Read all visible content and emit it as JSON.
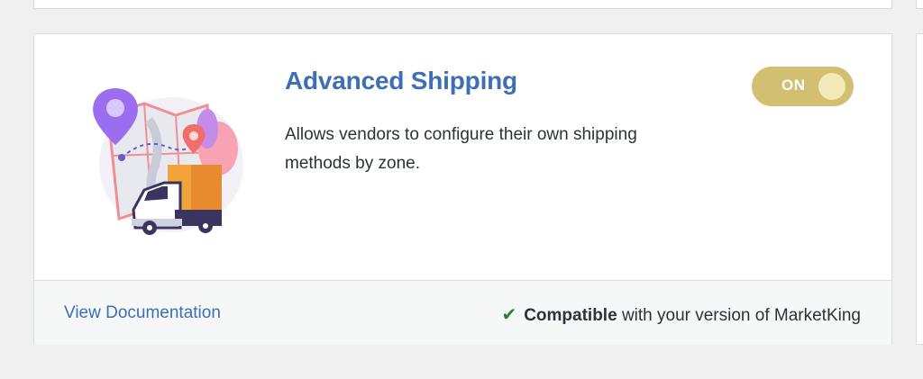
{
  "module": {
    "title": "Advanced Shipping",
    "description": "Allows vendors to configure their own shipping methods by zone.",
    "toggle": {
      "label": "ON",
      "state": "on",
      "color": "#d2bf72"
    },
    "illustration_icon": "shipping-map-truck-illustration"
  },
  "footer": {
    "documentation_link": "View Documentation",
    "compat_strong": "Compatible",
    "compat_rest": "with your version of MarketKing",
    "check_icon": "checkmark-icon"
  },
  "colors": {
    "link": "#3c6fb3",
    "check": "#2e7d32",
    "toggle_bg": "#d2bf72"
  }
}
